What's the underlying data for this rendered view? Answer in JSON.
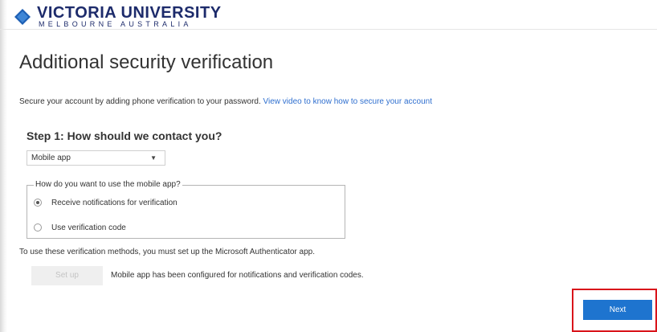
{
  "brand": {
    "name": "VICTORIA UNIVERSITY",
    "subtitle": "MELBOURNE AUSTRALIA",
    "color": "#1d2b6b"
  },
  "page": {
    "title": "Additional security verification",
    "intro_text": "Secure your account by adding phone verification to your password.",
    "intro_link": "View video to know how to secure your account"
  },
  "step1": {
    "title": "Step 1: How should we contact you?",
    "contact_method": "Mobile app",
    "mobile_question": "How do you want to use the mobile app?",
    "options": [
      {
        "label": "Receive notifications for verification",
        "selected": true
      },
      {
        "label": "Use verification code",
        "selected": false
      }
    ],
    "note": "To use these verification methods, you must set up the Microsoft Authenticator app.",
    "setup_label": "Set up",
    "setup_status": "Mobile app has been configured for notifications and verification codes."
  },
  "actions": {
    "next_label": "Next",
    "accent": "#1e74cf",
    "highlight_color": "#d9141b"
  }
}
